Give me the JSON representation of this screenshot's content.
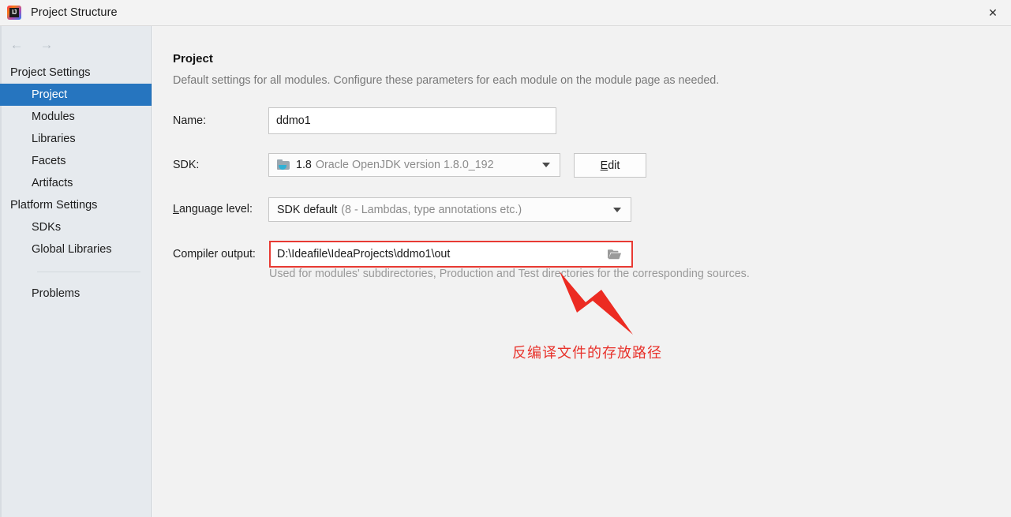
{
  "window": {
    "title": "Project Structure",
    "app_icon": "intellij-idea-icon",
    "close_label": "✕"
  },
  "nav": {
    "back_icon": "←",
    "forward_icon": "→"
  },
  "sidebar": {
    "groups": [
      {
        "label": "Project Settings",
        "items": [
          {
            "label": "Project",
            "selected": true
          },
          {
            "label": "Modules",
            "selected": false
          },
          {
            "label": "Libraries",
            "selected": false
          },
          {
            "label": "Facets",
            "selected": false
          },
          {
            "label": "Artifacts",
            "selected": false
          }
        ]
      },
      {
        "label": "Platform Settings",
        "items": [
          {
            "label": "SDKs",
            "selected": false
          },
          {
            "label": "Global Libraries",
            "selected": false
          }
        ]
      }
    ],
    "footer_item": {
      "label": "Problems"
    }
  },
  "main": {
    "title": "Project",
    "subtitle": "Default settings for all modules. Configure these parameters for each module on the module page as needed.",
    "fields": {
      "name": {
        "label": "Name:",
        "value": "ddmo1"
      },
      "sdk": {
        "label": "SDK:",
        "icon": "jdk-folder-icon",
        "value_strong": "1.8",
        "value_dim": "Oracle OpenJDK version 1.8.0_192",
        "edit_button": {
          "mnemonic": "E",
          "rest": "dit"
        }
      },
      "language_level": {
        "label_mnemonic": "L",
        "label_rest": "anguage level:",
        "value_strong": "SDK default",
        "value_dim": "(8 - Lambdas, type annotations etc.)"
      },
      "compiler_output": {
        "label": "Compiler output:",
        "value": "D:\\Ideafile\\IdeaProjects\\ddmo1\\out",
        "browse_icon": "open-folder-icon",
        "hint": "Used for modules' subdirectories, Production and Test directories for the corresponding sources.",
        "highlighted": true
      }
    }
  },
  "annotation": {
    "text": "反编译文件的存放路径",
    "arrow": "red-arrow-pointing-up-left"
  },
  "colors": {
    "accent_selected": "#2675bf",
    "annotation_red": "#e8322b",
    "highlight_border": "#e83a33",
    "sidebar_bg": "#e6eaee",
    "main_bg": "#f2f2f2"
  }
}
